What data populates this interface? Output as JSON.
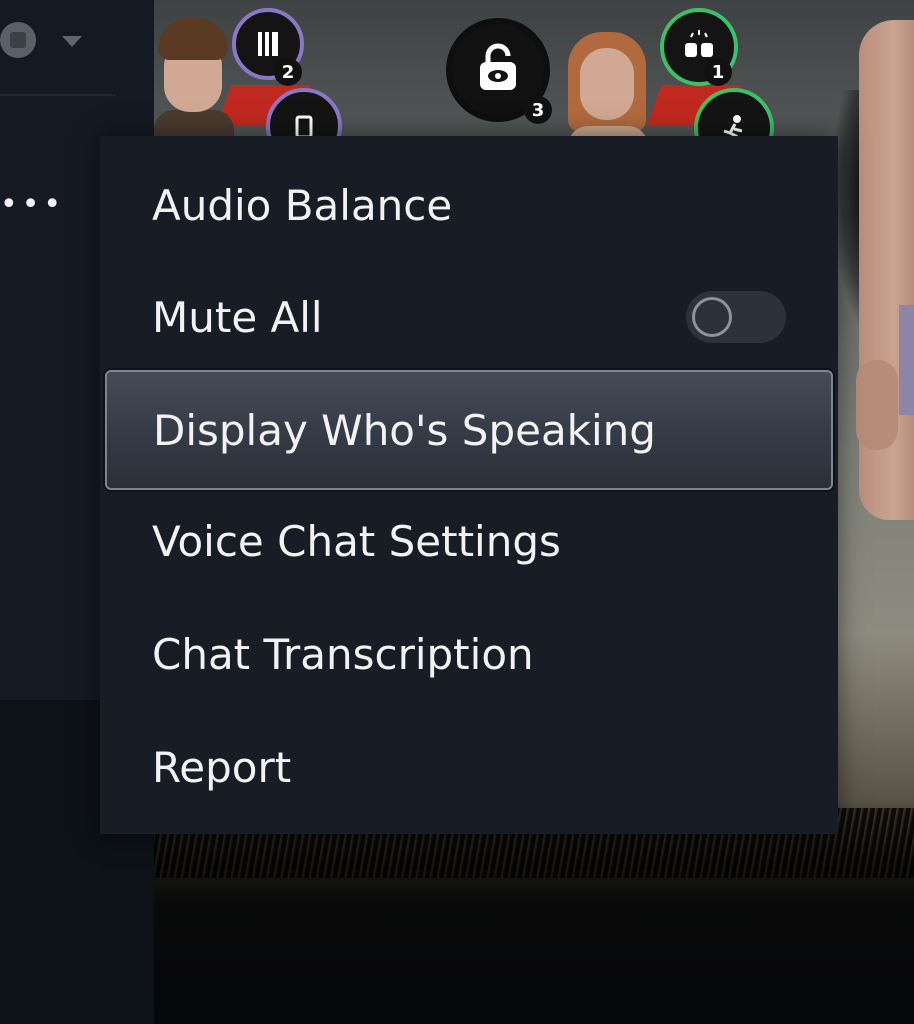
{
  "menu": {
    "items": [
      {
        "label": "Audio Balance"
      },
      {
        "label": "Mute All",
        "toggle": {
          "on": false
        }
      },
      {
        "label": "Display Who's Speaking",
        "selected": true
      },
      {
        "label": "Voice Chat Settings"
      },
      {
        "label": "Chat Transcription"
      },
      {
        "label": "Report"
      }
    ]
  },
  "sidebar": {
    "more_icon": "more-horizontal-icon",
    "caret_icon": "chevron-down-icon"
  },
  "game": {
    "perks": [
      {
        "count": "2"
      },
      {
        "count": "3"
      },
      {
        "count": "1"
      }
    ]
  },
  "colors": {
    "menu_bg": "#171c25",
    "selected_bg": "#3a404b",
    "selected_border": "#7c8593",
    "text": "#f2f2f2",
    "sidebar_bg": "#141a24"
  }
}
